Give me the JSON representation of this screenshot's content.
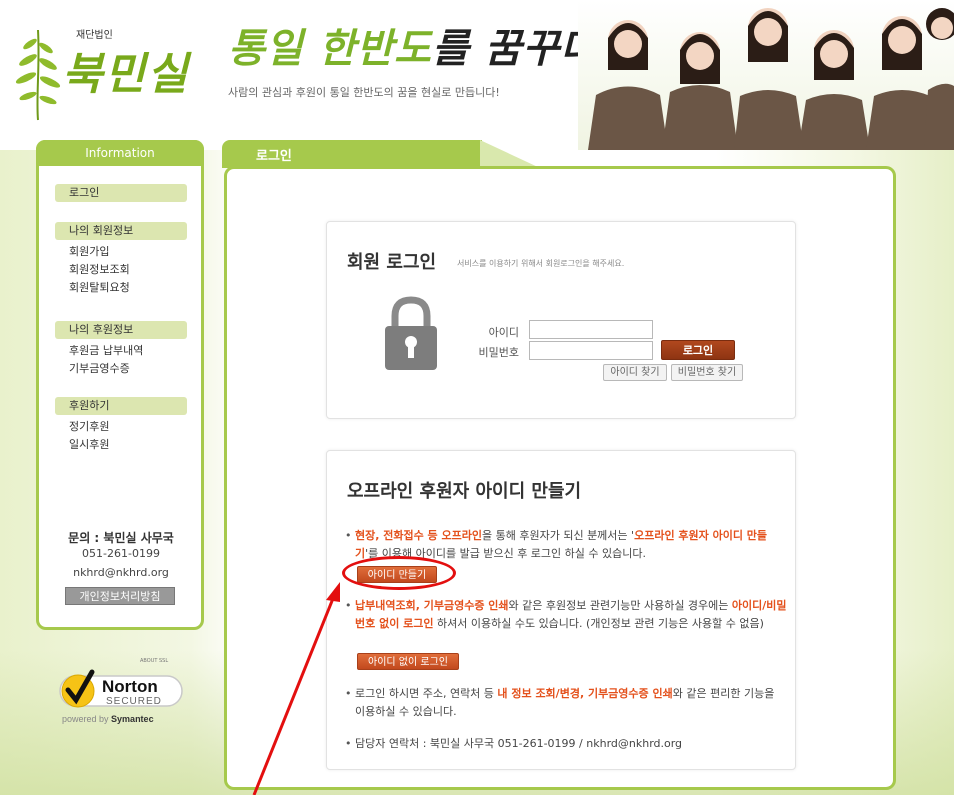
{
  "header": {
    "org_small": "재단법인",
    "logo": "북민실",
    "slogan_green": "통일 한반도",
    "slogan_dark": "를 꿈꾸다",
    "subslogan": "사람의 관심과 후원이 통일 한반도의 꿈을 현실로 만듭니다!"
  },
  "sidebar": {
    "tab": "Information",
    "login": "로그인",
    "member_section": "나의 회원정보",
    "member_items": [
      "회원가입",
      "회원정보조회",
      "회원탈퇴요청"
    ],
    "donor_section": "나의 후원정보",
    "donor_items": [
      "후원금 납부내역",
      "기부금영수증"
    ],
    "donate_section": "후원하기",
    "donate_items": [
      "정기후원",
      "일시후원"
    ],
    "contact_title": "문의 : 북민실 사무국",
    "contact_phone": "051-261-0199",
    "contact_email": "nkhrd@nkhrd.org",
    "privacy_button": "개인정보처리방침"
  },
  "norton": {
    "brand": "Norton",
    "secured": "SECURED",
    "powered": "powered by",
    "vendor": "Symantec",
    "tag": "ABOUT SSL"
  },
  "main": {
    "tab": "로그인",
    "login_box": {
      "title": "회원 로그인",
      "subtitle": "서비스를 이용하기 위해서 회원로그인을 해주세요.",
      "id_label": "아이디",
      "pw_label": "비밀번호",
      "id_value": "",
      "pw_value": "",
      "login_button": "로그인",
      "find_id": "아이디 찾기",
      "find_pw": "비밀번호 찾기"
    },
    "offline_box": {
      "title": "오프라인 후원자 아이디 만들기",
      "p1_hl": "현장, 전화접수 등 오프라인",
      "p1_a": "을 통해 후원자가 되신 분께서는 '",
      "p1_hl2": "오프라인 후원자 아이디 만들기",
      "p1_b": "'를 이용해 아이디를 발급 받으신 후 로그인 하실 수 있습니다.",
      "make_id_button": "아이디 만들기",
      "p2_hl": "납부내역조회, 기부금영수증 인쇄",
      "p2_a": "와 같은 후원정보 관련기능만 사용하실 경우에는 ",
      "p2_hl2": "아이디/비밀번호 없이 로그인",
      "p2_b": " 하셔서 이용하실 수도 있습니다. (개인정보 관련 기능은 사용할 수 없음)",
      "no_id_button": "아이디 없이 로그인",
      "p3_a": "로그인 하시면 주소, 연락처 등 ",
      "p3_hl": "내 정보 조회/변경, 기부금영수증 인쇄",
      "p3_b": "와 같은 편리한 기능을 이용하실 수 있습니다.",
      "p4": "담당자 연락처 : 북민실 사무국 051-261-0199 / nkhrd@nkhrd.org"
    }
  },
  "colors": {
    "accent_green": "#a6c94c",
    "highlight_orange": "#e4511c",
    "login_brown": "#8e3412",
    "annotation_red": "#e30f0f"
  }
}
